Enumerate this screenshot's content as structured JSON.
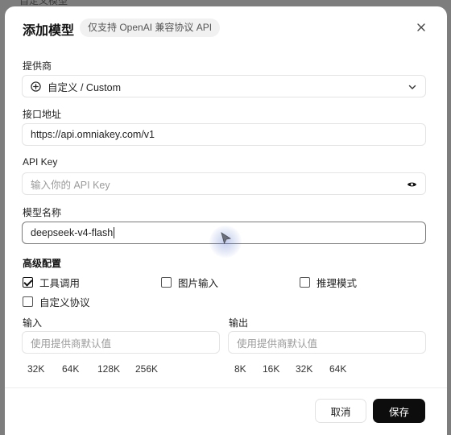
{
  "backdrop": {
    "text": "自定义模型"
  },
  "dialog": {
    "title": "添加模型",
    "badge": "仅支持 OpenAI 兼容协议 API",
    "close_icon": "close-icon"
  },
  "provider": {
    "label": "提供商",
    "value": "自定义 / Custom",
    "icon": "plus-circle-icon"
  },
  "endpoint": {
    "label": "接口地址",
    "value": "https://api.omniakey.com/v1"
  },
  "api_key": {
    "label": "API Key",
    "placeholder": "输入你的 API Key",
    "icon": "eye-icon"
  },
  "model_name": {
    "label": "模型名称",
    "value": "deepseek-v4-flash"
  },
  "advanced": {
    "title": "高级配置",
    "options": [
      {
        "label": "工具调用",
        "checked": true
      },
      {
        "label": "图片输入",
        "checked": false
      },
      {
        "label": "推理模式",
        "checked": false
      },
      {
        "label": "自定义协议",
        "checked": false
      }
    ]
  },
  "input_tokens": {
    "label": "输入",
    "placeholder": "使用提供商默认值",
    "presets": [
      "32K",
      "64K",
      "128K",
      "256K"
    ]
  },
  "output_tokens": {
    "label": "输出",
    "placeholder": "使用提供商默认值",
    "presets": [
      "8K",
      "16K",
      "32K",
      "64K"
    ]
  },
  "footer": {
    "cancel_label": "取消",
    "save_label": "保存"
  }
}
